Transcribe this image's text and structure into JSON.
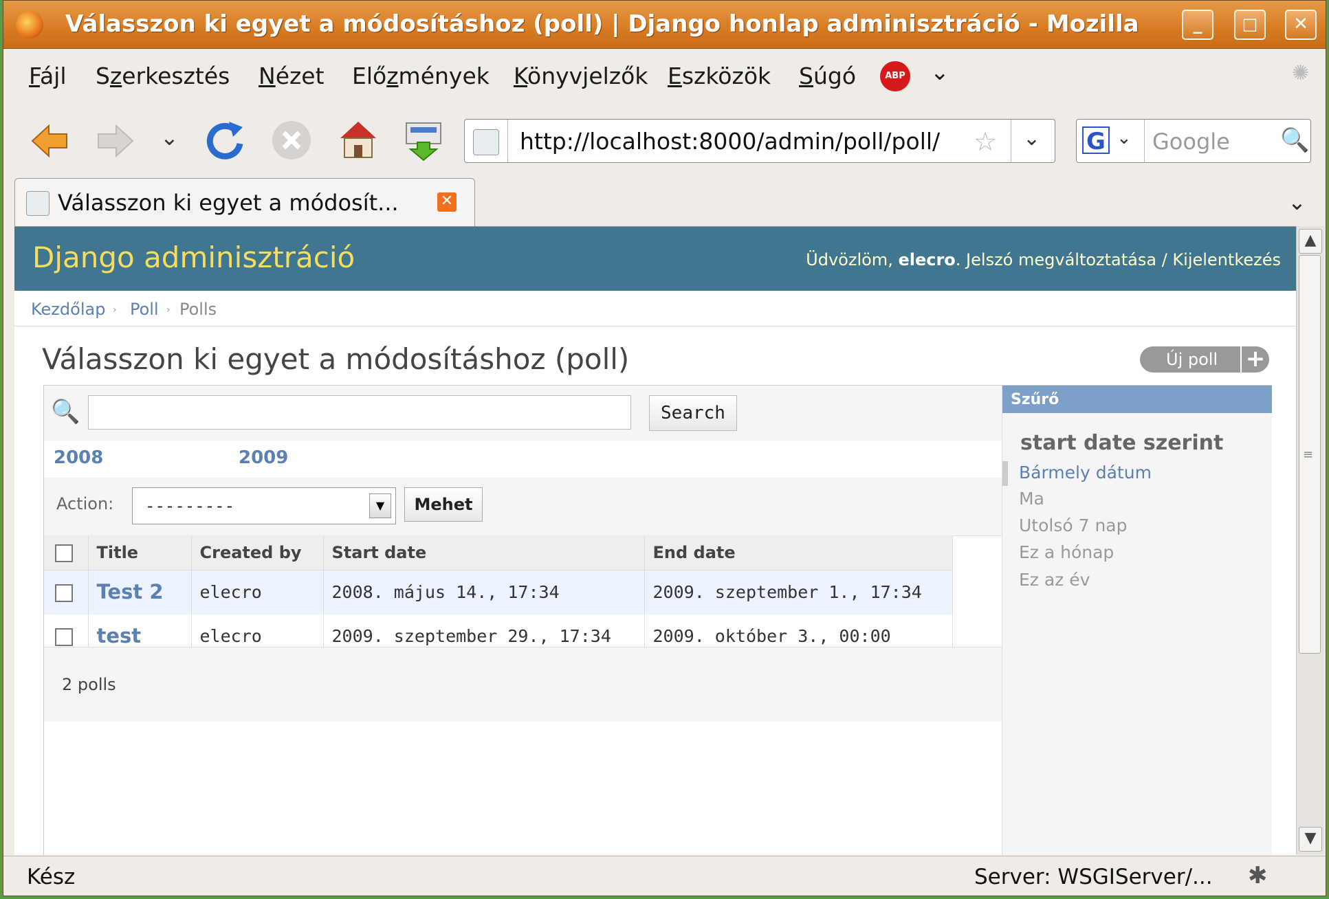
{
  "window": {
    "title": "Válasszon ki egyet a módosításhoz (poll) | Django honlap adminisztráció - Mozilla",
    "controls": {
      "minimize": "_",
      "maximize": "□",
      "close": "✕"
    }
  },
  "menu": {
    "items": [
      {
        "pre": "",
        "u": "F",
        "post": "ájl"
      },
      {
        "pre": "S",
        "u": "z",
        "post": "erkesztés"
      },
      {
        "pre": "",
        "u": "N",
        "post": "ézet"
      },
      {
        "pre": "Elő",
        "u": "z",
        "post": "mények"
      },
      {
        "pre": "",
        "u": "K",
        "post": "önyvjelzők"
      },
      {
        "pre": "",
        "u": "E",
        "post": "szközök"
      },
      {
        "pre": "",
        "u": "S",
        "post": "úgó"
      }
    ],
    "abp_label": "ABP"
  },
  "nav": {
    "url": "http://localhost:8000/admin/poll/poll/",
    "search_placeholder": "Google",
    "engine_letter": "G"
  },
  "tab": {
    "label": "Válasszon ki egyet a módosít...",
    "close": "✕"
  },
  "admin": {
    "branding": "Django adminisztráció",
    "user_greeting": "Üdvözlöm, ",
    "username": "elecro",
    "user_links": ". Jelszó megváltoztatása / Kijelentkezés",
    "breadcrumbs": {
      "home": "Kezdőlap",
      "app": "Poll",
      "current": "Polls",
      "sep": "›"
    },
    "page_title": "Válasszon ki egyet a módosításhoz (poll)",
    "add_button": "Új poll",
    "add_plus": "+",
    "search_button": "Search",
    "date_hierarchy": [
      "2008",
      "2009"
    ],
    "action_label": "Action:",
    "action_value": "---------",
    "action_go": "Mehet",
    "columns": [
      "Title",
      "Created by",
      "Start date",
      "End date"
    ],
    "rows": [
      {
        "title": "Test 2",
        "created_by": "elecro",
        "start": "2008. május 14., 17:34",
        "end": "2009. szeptember 1., 17:34"
      },
      {
        "title": "test",
        "created_by": "elecro",
        "start": "2009. szeptember 29., 17:34",
        "end": "2009. október 3., 00:00"
      }
    ],
    "result_count": "2 polls",
    "filter": {
      "header": "Szűrő",
      "title": "start date szerint",
      "items": [
        "Bármely dátum",
        "Ma",
        "Utolsó 7 nap",
        "Ez a hónap",
        "Ez az év"
      ],
      "selected_index": 0
    }
  },
  "status": {
    "left": "Kész",
    "right": "Server: WSGIServer/..."
  }
}
